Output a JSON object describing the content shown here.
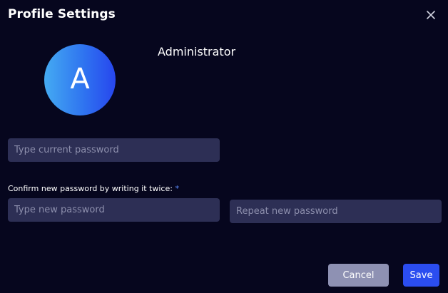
{
  "dialog": {
    "title": "Profile Settings",
    "close_icon": "close-icon"
  },
  "profile": {
    "avatar_letter": "A",
    "username": "Administrator"
  },
  "form": {
    "current_password_placeholder": "Type current password",
    "confirm_label": "Confirm new password by writing it twice:",
    "required_marker": "*",
    "new_password_placeholder": "Type new password",
    "repeat_password_placeholder": "Repeat new password"
  },
  "actions": {
    "cancel_label": "Cancel",
    "save_label": "Save"
  },
  "colors": {
    "background": "#06061e",
    "input_background": "#2d2f55",
    "primary": "#2b4df0",
    "secondary": "#8e91b3",
    "required": "#5c8cff"
  }
}
